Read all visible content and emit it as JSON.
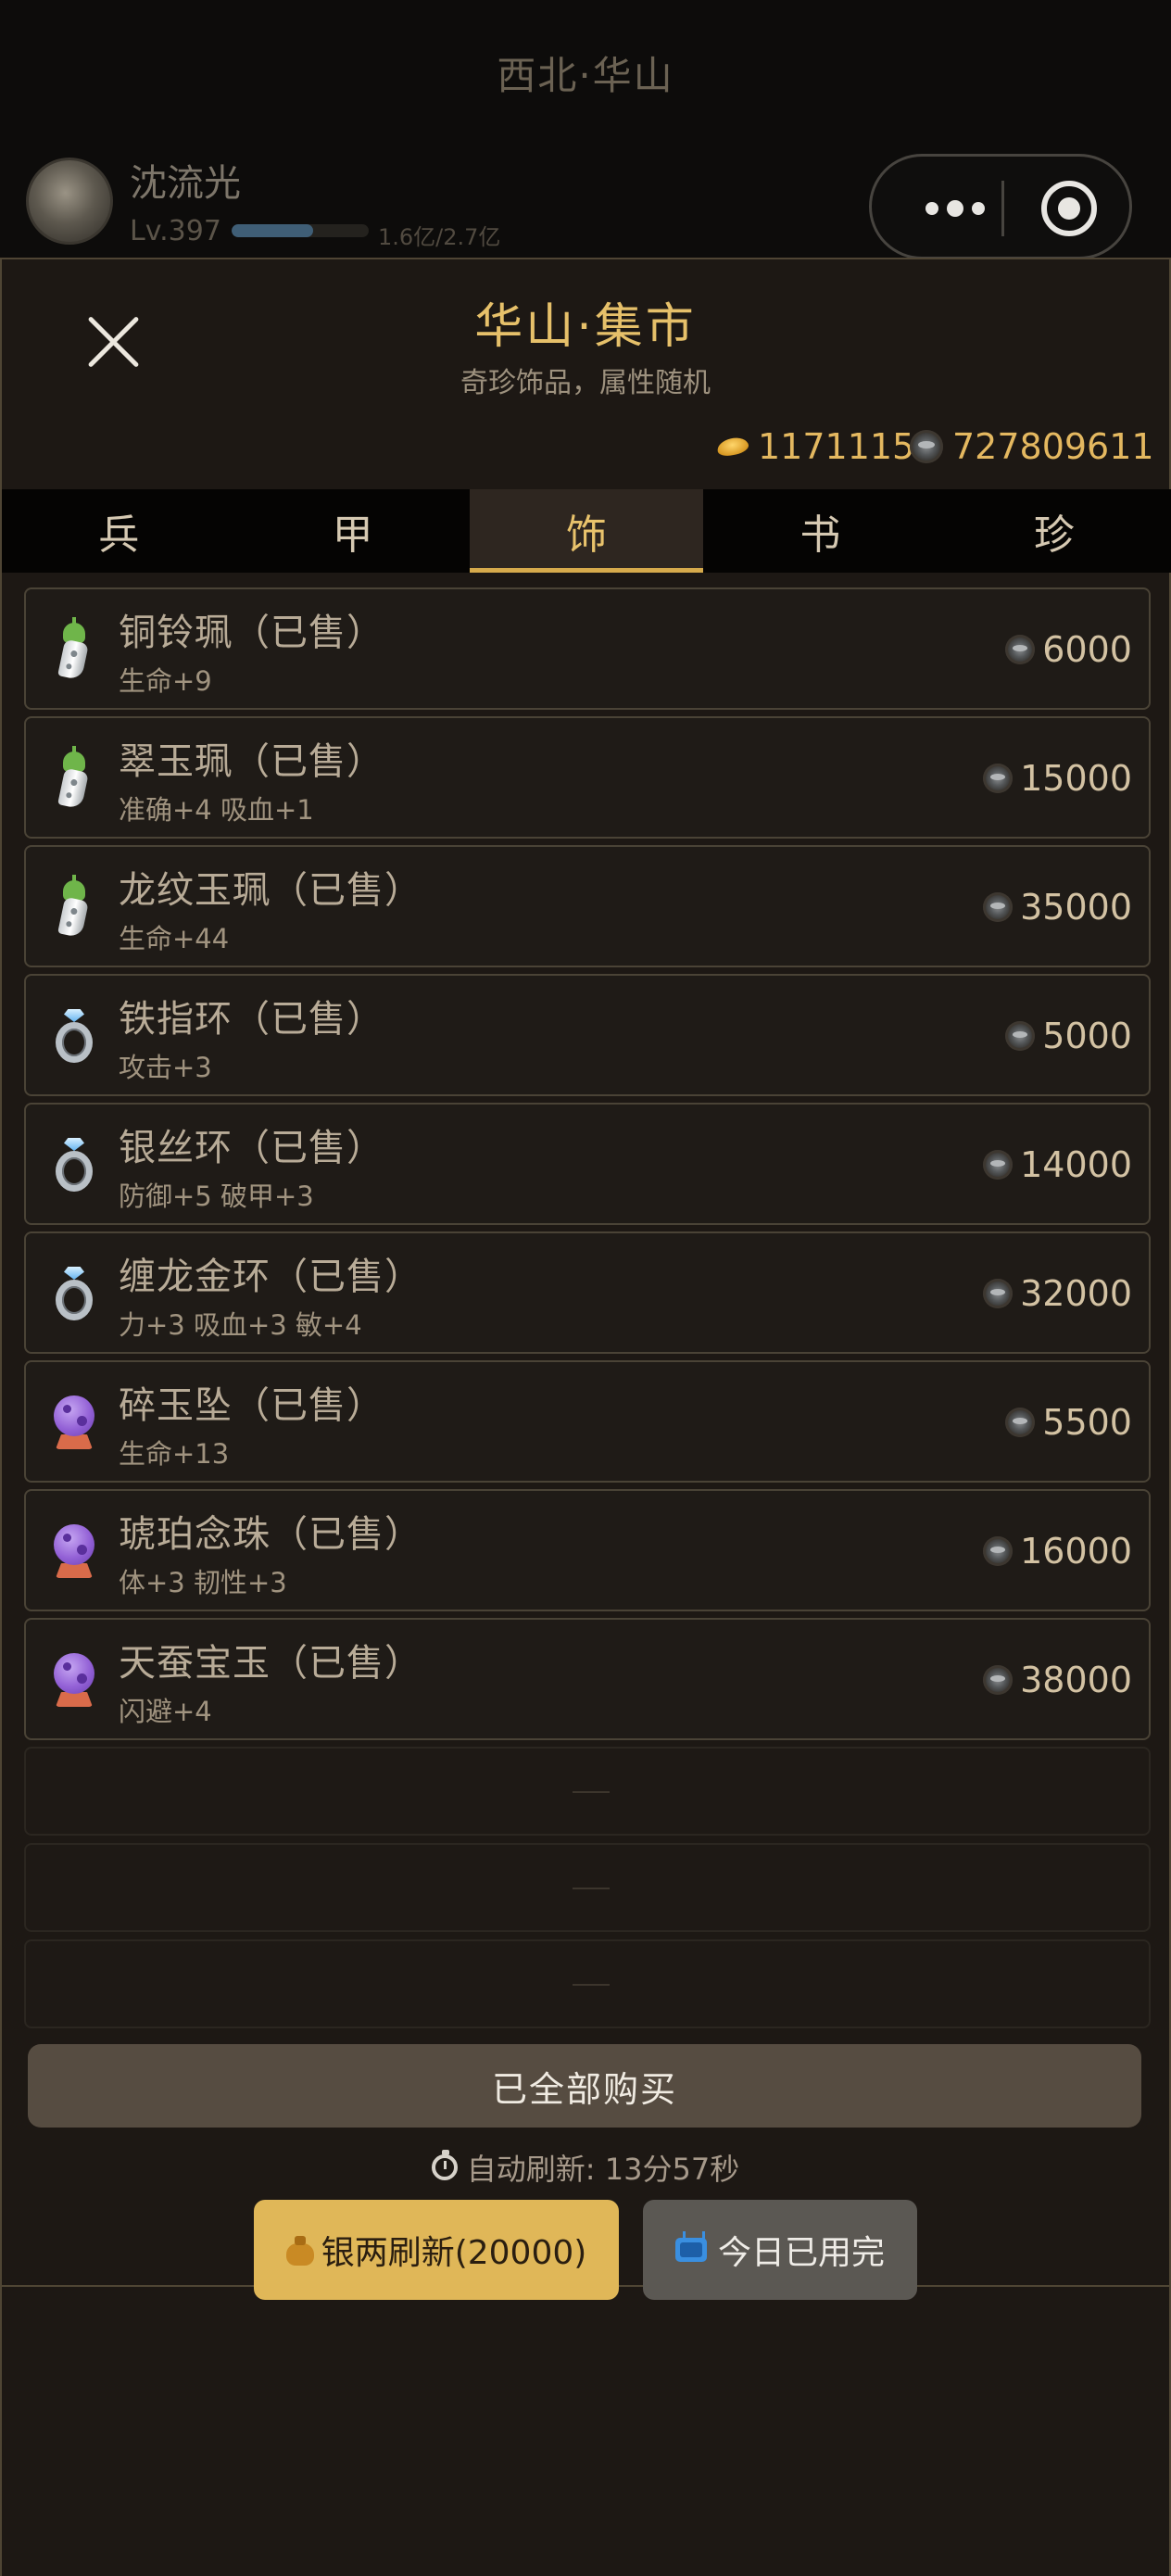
{
  "header": {
    "location": "西北·华山",
    "player": {
      "name": "沈流光",
      "level": "Lv.397",
      "exp_text": "1.6亿/2.7亿",
      "exp_fraction": 0.593
    }
  },
  "shop": {
    "title": "华山·集市",
    "subtitle": "奇珍饰品，属性随机",
    "gold": "1171115",
    "silver": "727809611"
  },
  "tabs": [
    {
      "label": "兵",
      "active": false
    },
    {
      "label": "甲",
      "active": false
    },
    {
      "label": "饰",
      "active": true
    },
    {
      "label": "书",
      "active": false
    },
    {
      "label": "珍",
      "active": false
    }
  ],
  "items": [
    {
      "icon": "jade-pendant-icon",
      "name": "铜铃珮（已售）",
      "stats": "生命+9",
      "price": "6000"
    },
    {
      "icon": "jade-pendant-icon",
      "name": "翠玉珮（已售）",
      "stats": "准确+4 吸血+1",
      "price": "15000"
    },
    {
      "icon": "jade-pendant-icon",
      "name": "龙纹玉珮（已售）",
      "stats": "生命+44",
      "price": "35000"
    },
    {
      "icon": "ring-icon",
      "name": "铁指环（已售）",
      "stats": "攻击+3",
      "price": "5000"
    },
    {
      "icon": "ring-icon",
      "name": "银丝环（已售）",
      "stats": "防御+5 破甲+3",
      "price": "14000"
    },
    {
      "icon": "ring-icon",
      "name": "缠龙金环（已售）",
      "stats": "力+3 吸血+3 敏+4",
      "price": "32000"
    },
    {
      "icon": "crystal-orb-icon",
      "name": "碎玉坠（已售）",
      "stats": "生命+13",
      "price": "5500"
    },
    {
      "icon": "crystal-orb-icon",
      "name": "琥珀念珠（已售）",
      "stats": "体+3 韧性+3",
      "price": "16000"
    },
    {
      "icon": "crystal-orb-icon",
      "name": "天蚕宝玉（已售）",
      "stats": "闪避+4",
      "price": "38000"
    }
  ],
  "empty_slots": 3,
  "footer": {
    "buy_all_label": "已全部购买",
    "auto_refresh": "自动刷新: 13分57秒",
    "silver_refresh_label": "银两刷新(20000)",
    "daily_label": "今日已用完"
  },
  "colors": {
    "accent_gold": "#e6c06a",
    "tab_active_underline": "#d6aa4c",
    "refresh_button": "#e0b758"
  }
}
